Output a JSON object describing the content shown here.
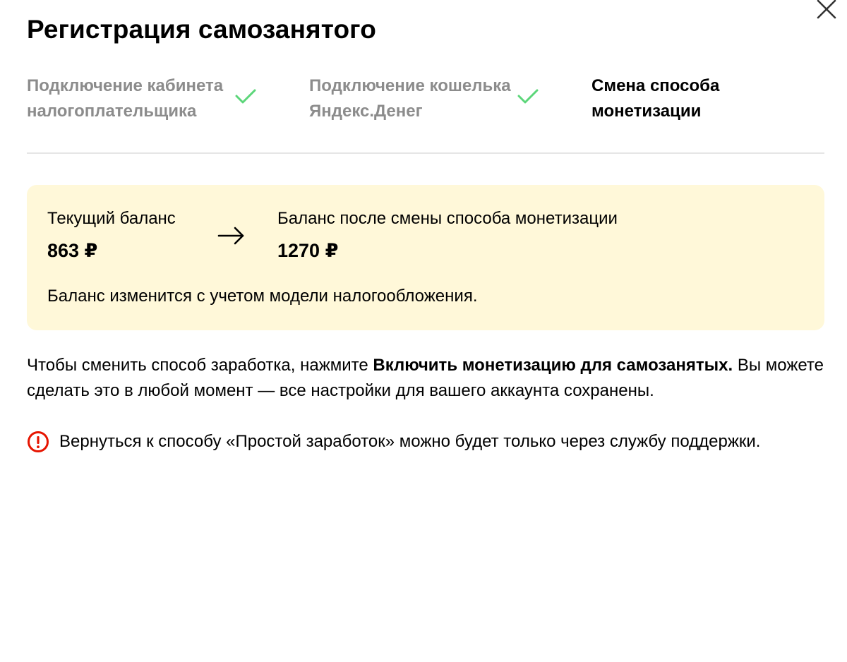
{
  "dialog": {
    "title": "Регистрация самозанятого",
    "close_icon": "close-icon"
  },
  "steps": [
    {
      "line1": "Подключение кабинета",
      "line2": "налогоплательщика",
      "state": "done",
      "icon": "checkmark-icon"
    },
    {
      "line1": "Подключение кошелька",
      "line2": "Яндекс.Денег",
      "state": "done",
      "icon": "checkmark-icon"
    },
    {
      "line1": "Смена способа",
      "line2": "монетизации",
      "state": "current"
    }
  ],
  "balance": {
    "current_label": "Текущий баланс",
    "current_value": "863 ₽",
    "arrow_icon": "arrow-right-icon",
    "new_label": "Баланс после смены способа монетизации",
    "new_value": "1270 ₽",
    "note": "Баланс изменится с учетом модели налогообложения."
  },
  "info": {
    "prefix": "Чтобы сменить способ заработка, нажмите ",
    "bold": "Включить монетизацию для самозанятых.",
    "suffix": " Вы можете сделать это в любой момент — все настройки для вашего аккаунта сохранены."
  },
  "warning": {
    "icon": "exclamation-circle-icon",
    "text": "Вернуться к способу «Простой заработок» можно будет только через службу поддержки."
  },
  "colors": {
    "check_green": "#5cd67a",
    "warning_red": "#e61400",
    "card_background": "#fff8d9",
    "step_inactive_text": "#8c8c8c",
    "divider": "#e6e6e6"
  }
}
